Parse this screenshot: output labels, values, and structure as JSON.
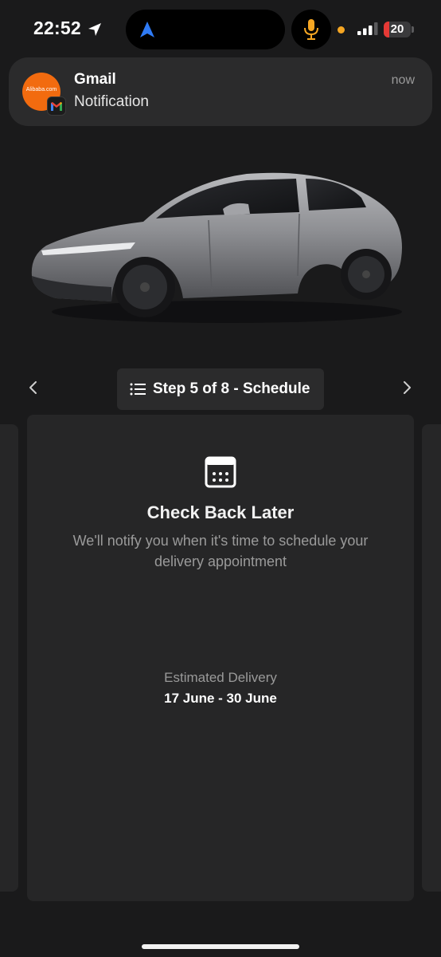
{
  "status_bar": {
    "time": "22:52",
    "battery_level": 20,
    "battery_fraction": 0.2,
    "signal_bars_active": 3,
    "signal_bars_total": 4
  },
  "notification": {
    "app": "Gmail",
    "message": "Notification",
    "time": "now",
    "logo_text": "Alibaba.com"
  },
  "step_nav": {
    "label": "Step 5 of 8 - Schedule"
  },
  "card": {
    "title": "Check Back Later",
    "description": "We'll notify you when it's time to schedule your delivery appointment",
    "estimated_label": "Estimated Delivery",
    "estimated_value": "17 June - 30 June"
  },
  "colors": {
    "background": "#1a1a1b",
    "card": "#262627",
    "accent_orange": "#f26b0f",
    "battery_low": "#e53935",
    "nav_blue": "#2f7bf6",
    "mic_orange": "#f5a623"
  },
  "icons": {
    "location": "location-arrow-icon",
    "navigation": "navigation-arrow-icon",
    "microphone": "microphone-icon",
    "list": "list-icon",
    "calendar": "calendar-icon",
    "prev": "chevron-left-icon",
    "next": "chevron-right-icon"
  }
}
